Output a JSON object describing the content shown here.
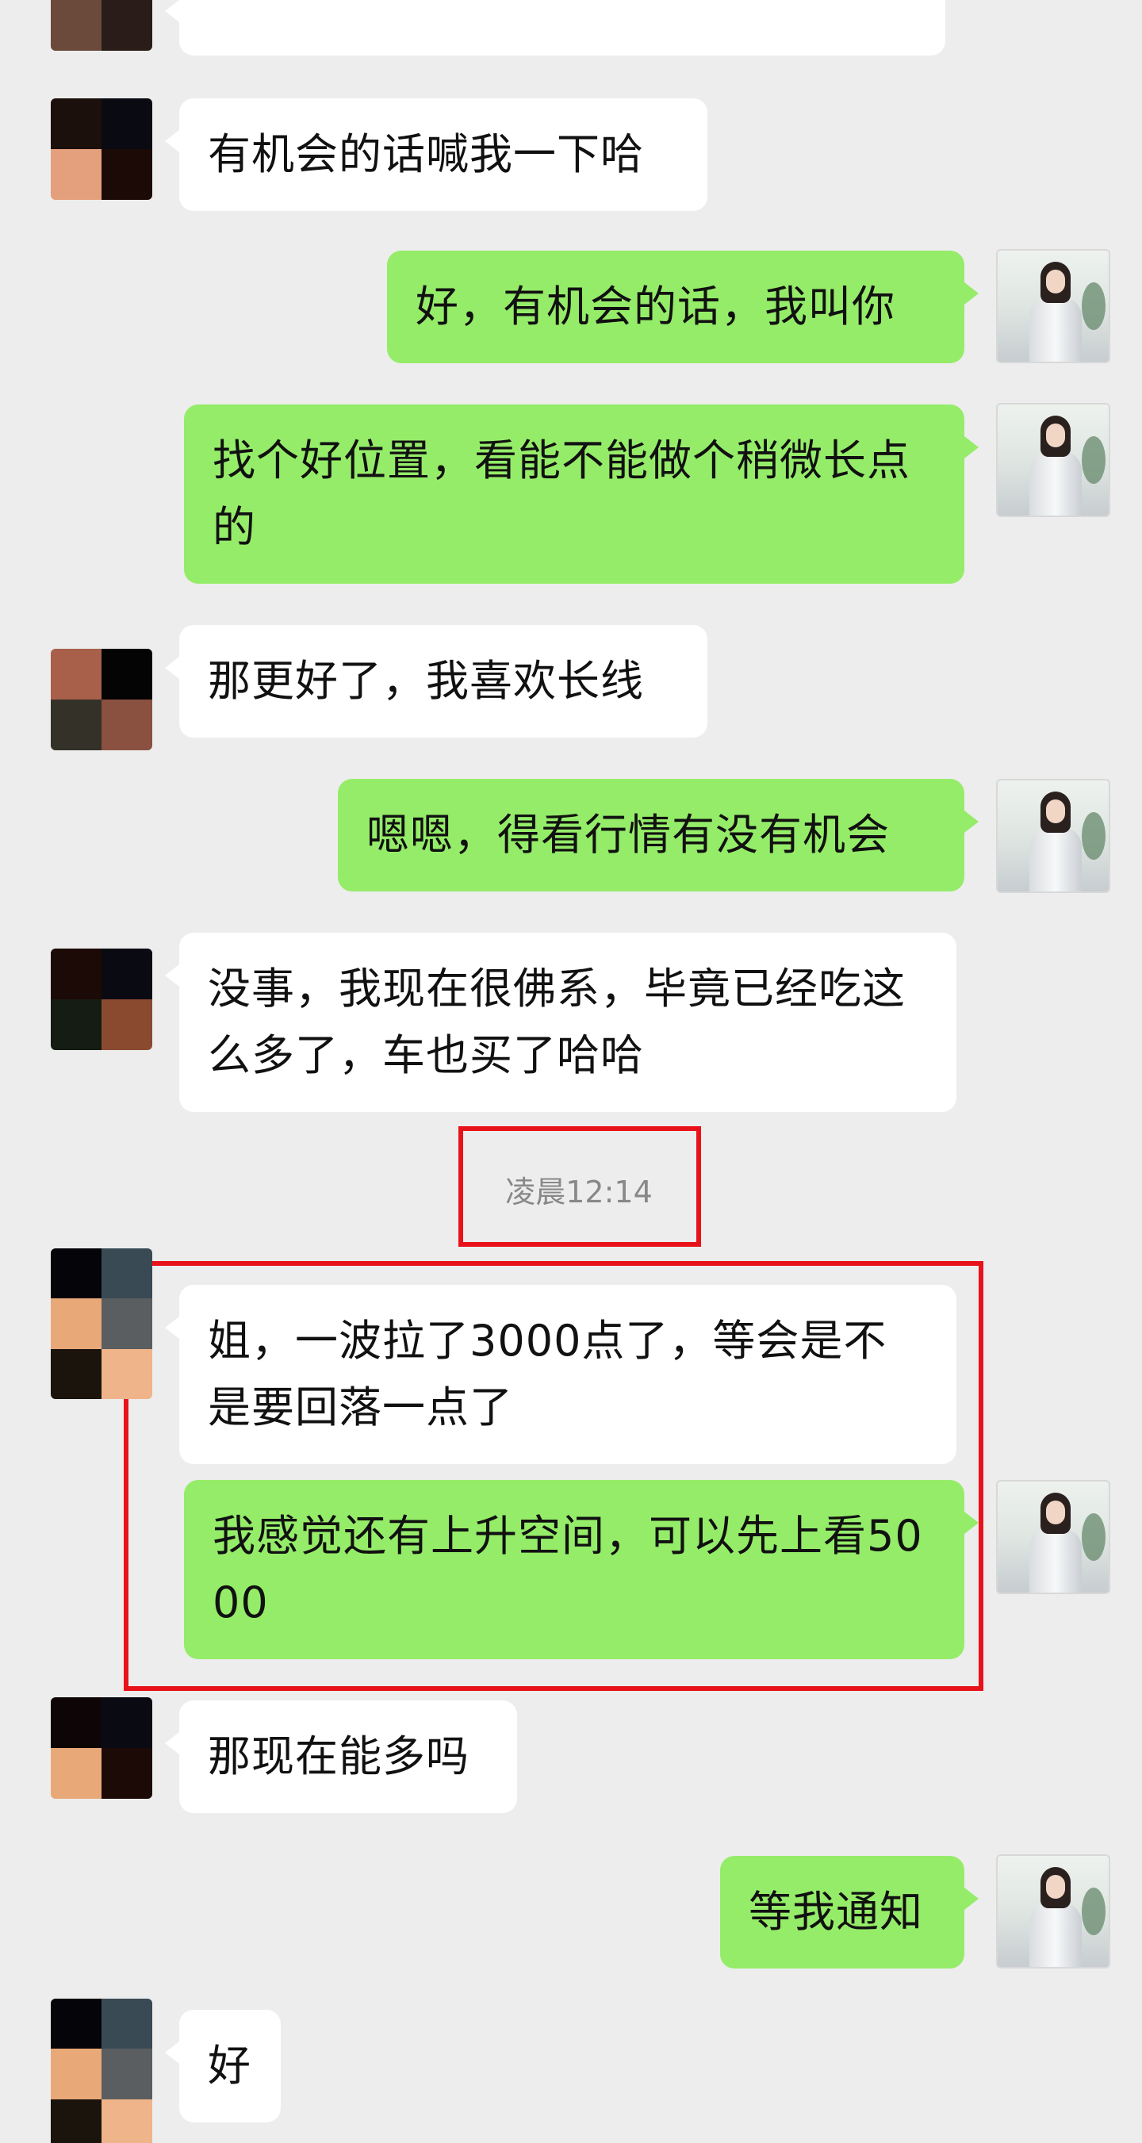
{
  "messages": [
    {
      "side": "in",
      "text": ""
    },
    {
      "side": "in",
      "text": "有机会的话喊我一下哈"
    },
    {
      "side": "out",
      "text": "好，有机会的话，我叫你"
    },
    {
      "side": "out",
      "text": "找个好位置，看能不能做个稍微长点的"
    },
    {
      "side": "in",
      "text": "那更好了，我喜欢长线"
    },
    {
      "side": "out",
      "text": "嗯嗯，得看行情有没有机会"
    },
    {
      "side": "in",
      "text": "没事，我现在很佛系，毕竟已经吃这么多了，车也买了哈哈"
    },
    {
      "side": "in",
      "text": "姐，一波拉了3000点了，等会是不是要回落一点了"
    },
    {
      "side": "out",
      "text": "我感觉还有上升空间，可以先上看5000"
    },
    {
      "side": "in",
      "text": "那现在能多吗"
    },
    {
      "side": "out",
      "text": "等我通知"
    },
    {
      "side": "in",
      "text": "好"
    }
  ],
  "timestamp": "凌晨12:14",
  "colors": {
    "background": "#ededed",
    "incoming_bubble": "#ffffff",
    "outgoing_bubble": "#95ec69",
    "highlight_box": "#e8131a",
    "timestamp_text": "#888888"
  },
  "avatars": {
    "contact": "pixelated-avatar",
    "self": "woman-photo-avatar"
  }
}
